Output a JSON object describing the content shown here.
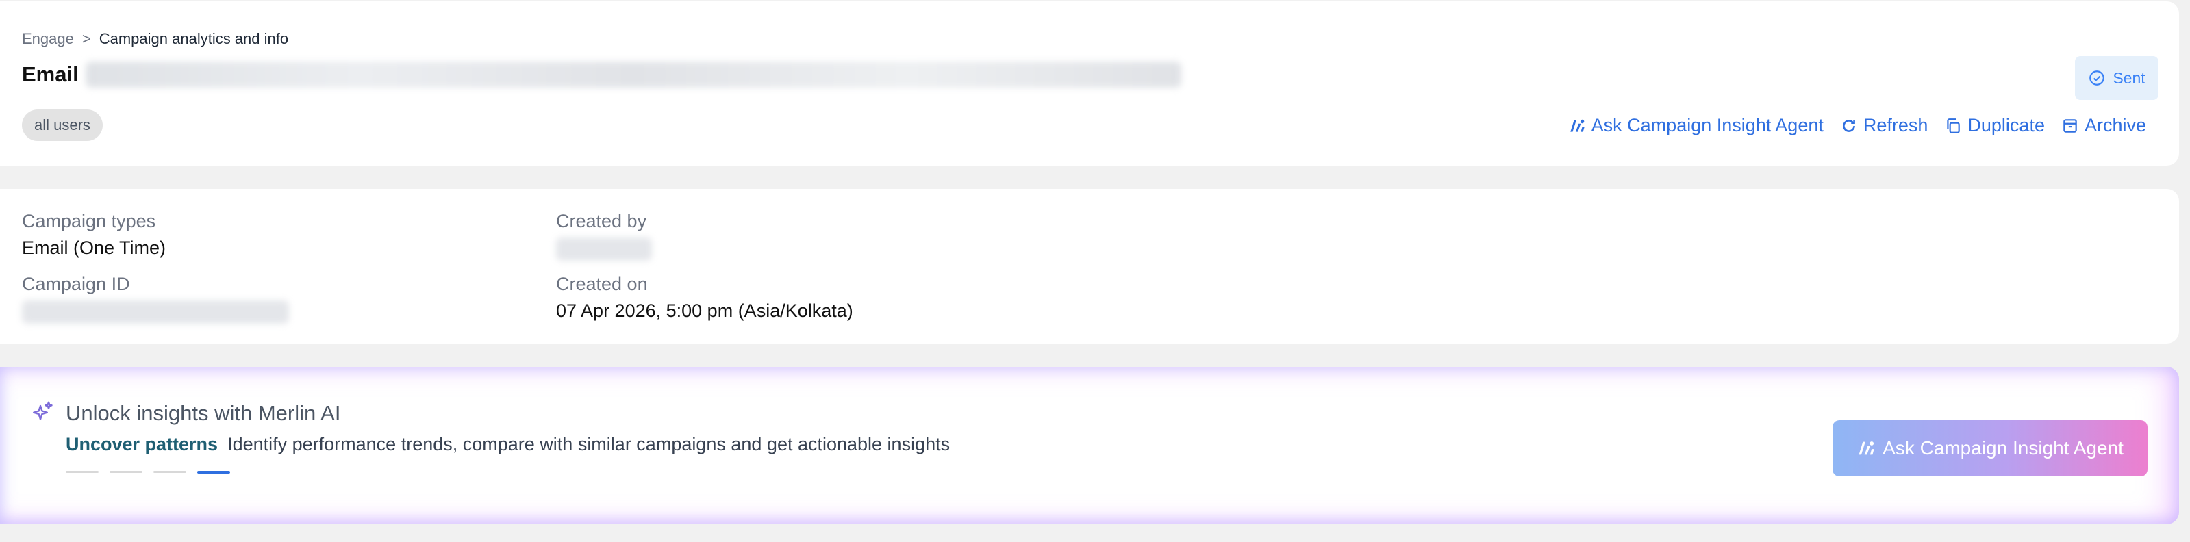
{
  "breadcrumb": {
    "root": "Engage",
    "separator": ">",
    "current": "Campaign analytics and info"
  },
  "header": {
    "title": "Email",
    "tag": "all users",
    "status": "Sent",
    "actions": {
      "ask_agent": "Ask Campaign Insight Agent",
      "refresh": "Refresh",
      "duplicate": "Duplicate",
      "archive": "Archive"
    }
  },
  "details": {
    "campaign_types_label": "Campaign types",
    "campaign_types_value": "Email (One Time)",
    "created_by_label": "Created by",
    "campaign_id_label": "Campaign ID",
    "created_on_label": "Created on",
    "created_on_value": "07 Apr 2026, 5:00 pm (Asia/Kolkata)"
  },
  "merlin": {
    "title": "Unlock insights with Merlin AI",
    "highlight": "Uncover patterns",
    "description": "Identify performance trends, compare with similar campaigns and get actionable insights",
    "carousel_active_index": 3,
    "button": "Ask Campaign Insight Agent"
  },
  "colors": {
    "accent": "#2f6fe0",
    "status": "#3b82f6",
    "gradient_start": "#8fb6f4",
    "gradient_end": "#ec7fcf"
  }
}
